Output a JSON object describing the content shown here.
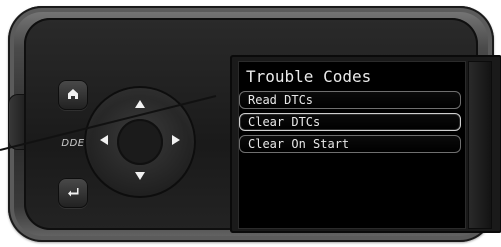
{
  "screen": {
    "title": "Trouble Codes",
    "menu_items": [
      {
        "label": "Read DTCs",
        "selected": false
      },
      {
        "label": "Clear DTCs",
        "selected": true
      },
      {
        "label": "Clear On Start",
        "selected": false
      }
    ]
  },
  "device": {
    "logo_text": "DDE"
  },
  "icons": {
    "home": "home-icon",
    "back": "back-enter-icon",
    "dpad_up": "arrow-up-icon",
    "dpad_down": "arrow-down-icon",
    "dpad_left": "arrow-left-icon",
    "dpad_right": "arrow-right-icon"
  },
  "colors": {
    "bezel_dark": "#1a1a1a",
    "screen_bg": "#000000",
    "text": "#eaeaea",
    "selection_border": "#cfcfcf"
  }
}
